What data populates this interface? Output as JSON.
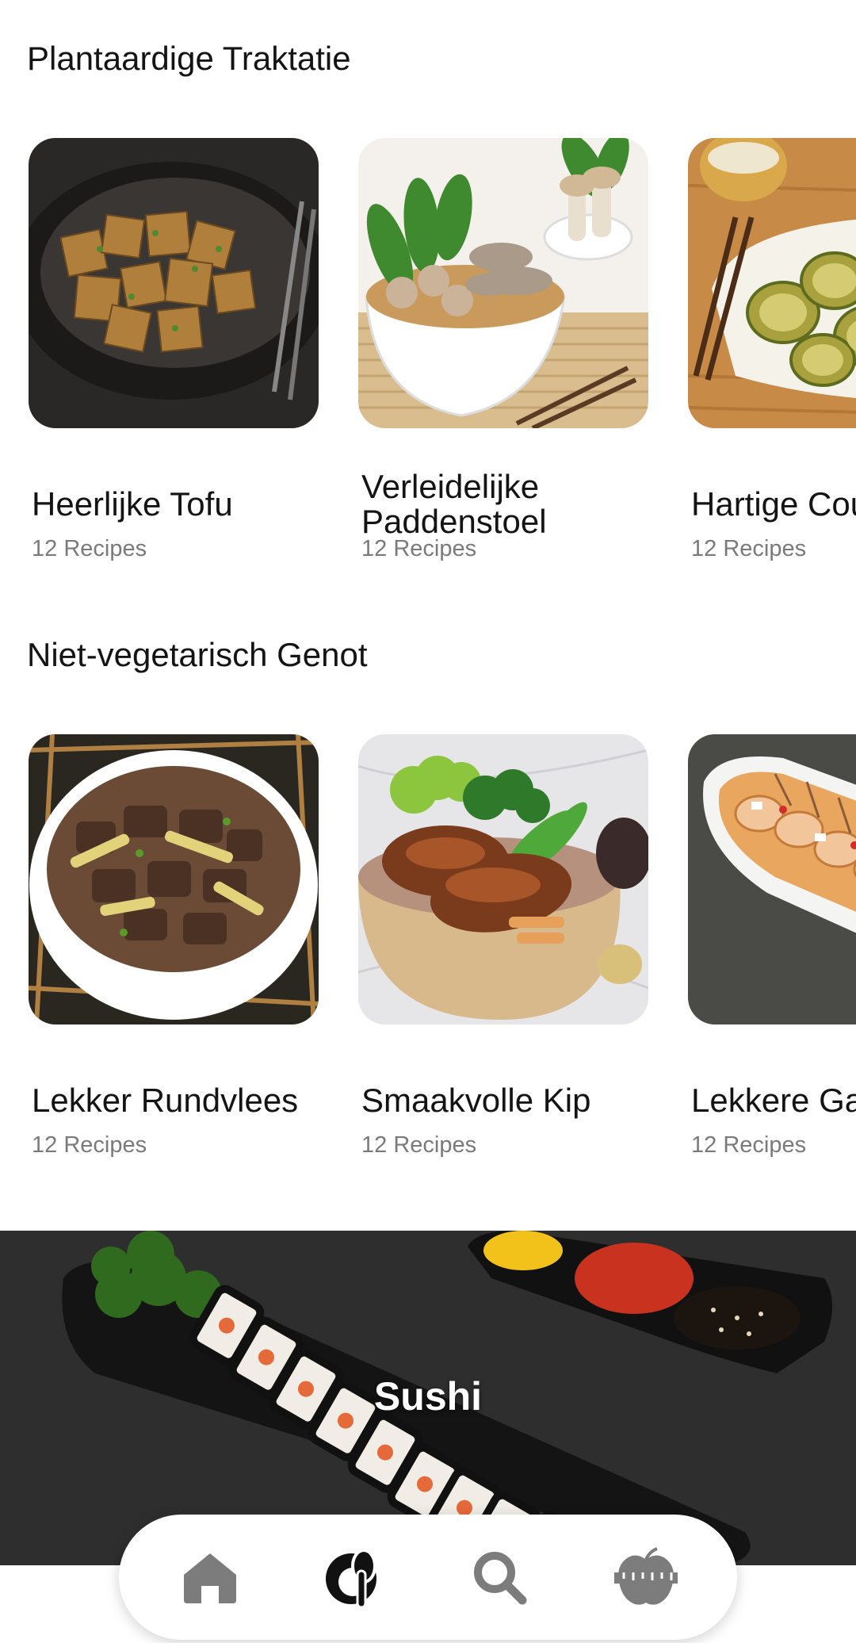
{
  "sections": [
    {
      "title": "Plantaardige Traktatie",
      "cards": [
        {
          "title": "Heerlijke Tofu",
          "count": "12 Recipes"
        },
        {
          "title": "Verleidelijke Paddenstoel",
          "count": "12 Recipes"
        },
        {
          "title": "Hartige Courgette",
          "count": "12 Recipes"
        }
      ]
    },
    {
      "title": "Niet-vegetarisch Genot",
      "cards": [
        {
          "title": "Lekker Rundvlees",
          "count": "12 Recipes"
        },
        {
          "title": "Smaakvolle Kip",
          "count": "12 Recipes"
        },
        {
          "title": "Lekkere Garnalen",
          "count": "12 Recipes"
        }
      ]
    }
  ],
  "banner": {
    "label": "Sushi"
  },
  "tabbar": {
    "items": [
      {
        "icon": "home-icon",
        "active": false
      },
      {
        "icon": "recipes-icon",
        "active": true
      },
      {
        "icon": "search-icon",
        "active": false
      },
      {
        "icon": "nutrition-icon",
        "active": false
      }
    ]
  },
  "colors": {
    "active_tab": "#111111",
    "inactive_tab": "#7c7c7c",
    "muted_text": "#7a7a7a"
  }
}
